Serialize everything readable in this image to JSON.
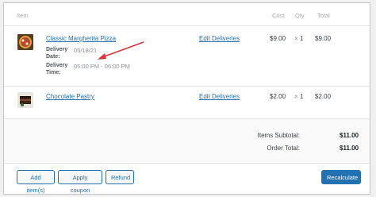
{
  "table": {
    "headers": {
      "item": "Item",
      "cost": "Cost",
      "qty": "Qty",
      "total": "Total"
    },
    "rows": [
      {
        "name": "Classic Margherita Pizza",
        "edit_link": "Edit Deliveries",
        "delivery_date_label": "Delivery Date:",
        "delivery_date": "05/18/21",
        "delivery_time_label": "Delivery Time:",
        "delivery_time": "05:00 PM - 06:00 PM",
        "cost": "$9.00",
        "qty_sign": "×",
        "qty": "1",
        "total": "$9.00",
        "thumb_icon": "pizza-thumbnail"
      },
      {
        "name": "Chocolate Pastry",
        "edit_link": "Edit Deliveries",
        "cost": "$2.00",
        "qty_sign": "×",
        "qty": "1",
        "total": "$2.00",
        "thumb_icon": "pastry-thumbnail"
      }
    ]
  },
  "totals": {
    "items_subtotal_label": "Items Subtotal:",
    "items_subtotal": "$11.00",
    "order_total_label": "Order Total:",
    "order_total": "$11.00"
  },
  "actions": {
    "add_items": "Add item(s)",
    "apply_coupon": "Apply coupon",
    "refund": "Refund",
    "recalculate": "Recalculate"
  },
  "colors": {
    "link": "#2271b1",
    "annotation_arrow": "#d63638"
  }
}
